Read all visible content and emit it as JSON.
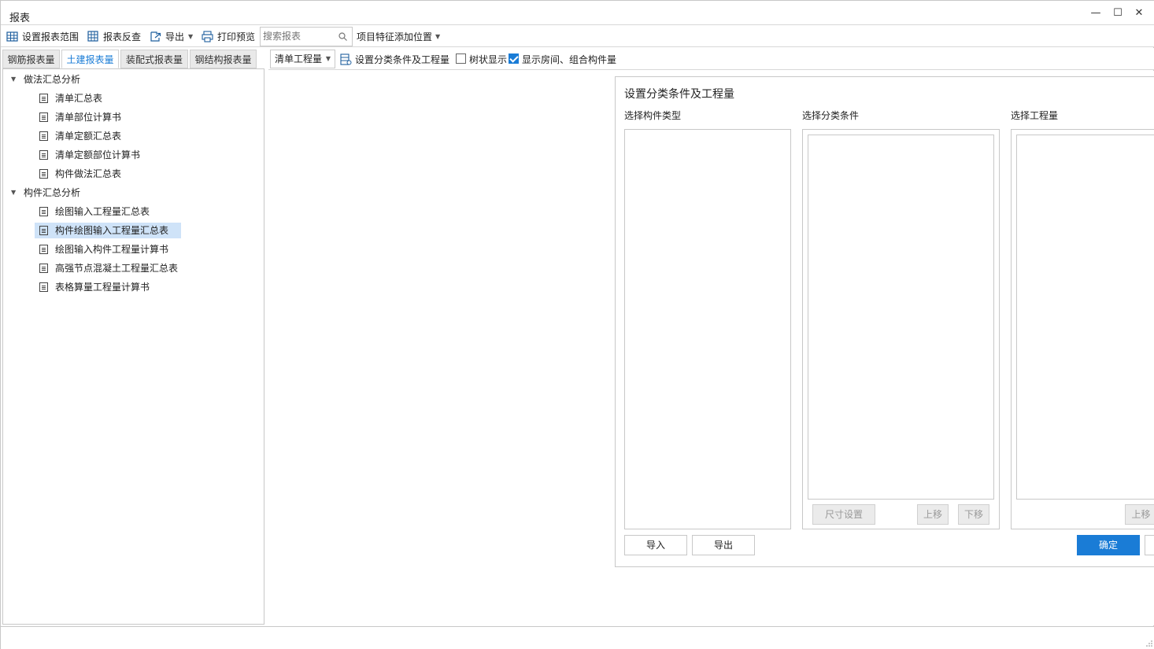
{
  "window": {
    "title": "报表"
  },
  "toolbar": {
    "set_range": "设置报表范围",
    "reverse_check": "报表反查",
    "export": "导出",
    "print_preview": "打印预览",
    "search_placeholder": "搜索报表",
    "feature_position": "项目特征添加位置"
  },
  "tabs": [
    {
      "label": "钢筋报表量",
      "active": false
    },
    {
      "label": "土建报表量",
      "active": true
    },
    {
      "label": "装配式报表量",
      "active": false
    },
    {
      "label": "钢结构报表量",
      "active": false
    }
  ],
  "tree": {
    "groups": [
      {
        "label": "做法汇总分析",
        "items": [
          "清单汇总表",
          "清单部位计算书",
          "清单定额汇总表",
          "清单定额部位计算书",
          "构件做法汇总表"
        ]
      },
      {
        "label": "构件汇总分析",
        "items": [
          "绘图输入工程量汇总表",
          "构件绘图输入工程量汇总表",
          "绘图输入构件工程量计算书",
          "高强节点混凝土工程量汇总表",
          "表格算量工程量计算书"
        ]
      }
    ],
    "selected": "构件绘图输入工程量汇总表"
  },
  "right_toolbar": {
    "qty_select": "清单工程量",
    "set_conditions": "设置分类条件及工程量",
    "tree_display": "树状显示",
    "tree_display_checked": false,
    "show_rooms": "显示房间、组合构件量",
    "show_rooms_checked": true
  },
  "dialog": {
    "title": "设置分类条件及工程量",
    "col_component_type": "选择构件类型",
    "col_conditions": "选择分类条件",
    "col_quantity": "选择工程量",
    "btn_import": "导入",
    "btn_export": "导出",
    "btn_size": "尺寸设置",
    "btn_up": "上移",
    "btn_down": "下移",
    "btn_up2": "上移",
    "btn_ok": "确定"
  },
  "colors": {
    "accent": "#1a7cd6",
    "selection": "#cfe3f8"
  }
}
